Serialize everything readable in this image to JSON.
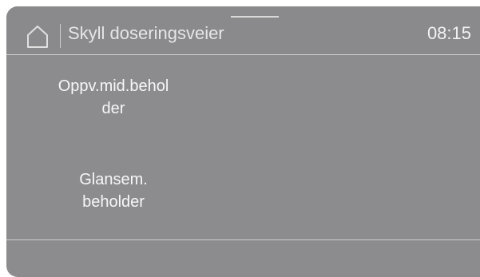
{
  "header": {
    "icon": "home-icon",
    "title": "Skyll doseringsveier",
    "time": "08:15"
  },
  "options": [
    {
      "line1": "Oppv.mid.behol",
      "line2": "der"
    },
    {
      "line1": "Glansem.",
      "line2": "beholder"
    }
  ],
  "colors": {
    "screen_background": "#8c8c8e",
    "text": "#f7f7f7"
  }
}
